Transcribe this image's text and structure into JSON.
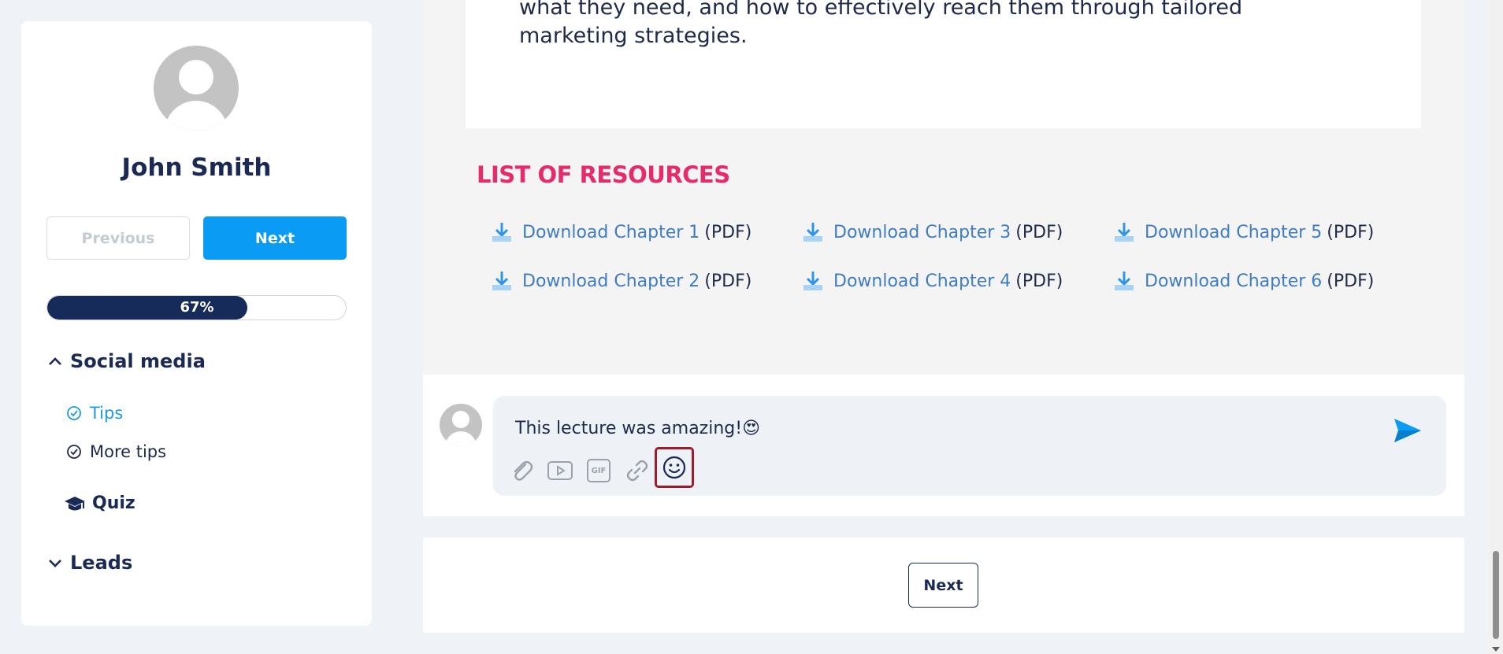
{
  "content": {
    "paragraph": "what they need, and how to effectively reach them through tailored marketing strategies."
  },
  "sidebar": {
    "user_name": "John Smith",
    "previous_label": "Previous",
    "next_label": "Next",
    "progress": {
      "percent": 67,
      "label": "67%"
    },
    "sections": [
      {
        "title": "Social media",
        "expanded": true,
        "lessons": [
          {
            "label": "Tips",
            "active": true
          },
          {
            "label": "More tips",
            "active": false
          }
        ],
        "quiz": "Quiz"
      },
      {
        "title": "Leads",
        "expanded": false
      }
    ]
  },
  "resources": {
    "title": "LIST OF RESOURCES",
    "items": [
      {
        "label": "Download Chapter 1",
        "ext": "(PDF)"
      },
      {
        "label": "Download Chapter 2",
        "ext": "(PDF)"
      },
      {
        "label": "Download Chapter 3",
        "ext": "(PDF)"
      },
      {
        "label": "Download Chapter 4",
        "ext": "(PDF)"
      },
      {
        "label": "Download Chapter 5",
        "ext": "(PDF)"
      },
      {
        "label": "Download Chapter 6",
        "ext": "(PDF)"
      }
    ]
  },
  "comment": {
    "text": "This lecture was amazing!",
    "emoji": "😍",
    "toolbar_icons": [
      "paperclip-icon",
      "video-icon",
      "gif-icon",
      "link-icon",
      "emoji-icon"
    ],
    "gif_label": "GIF",
    "send_icon": "send-icon"
  },
  "footer": {
    "next_label": "Next"
  },
  "colors": {
    "accent": "#0a9cf5",
    "navy": "#1b2a55",
    "resource_title": "#e62b6b",
    "link": "#3f7cc0",
    "highlight_border": "#9c1c2a"
  }
}
